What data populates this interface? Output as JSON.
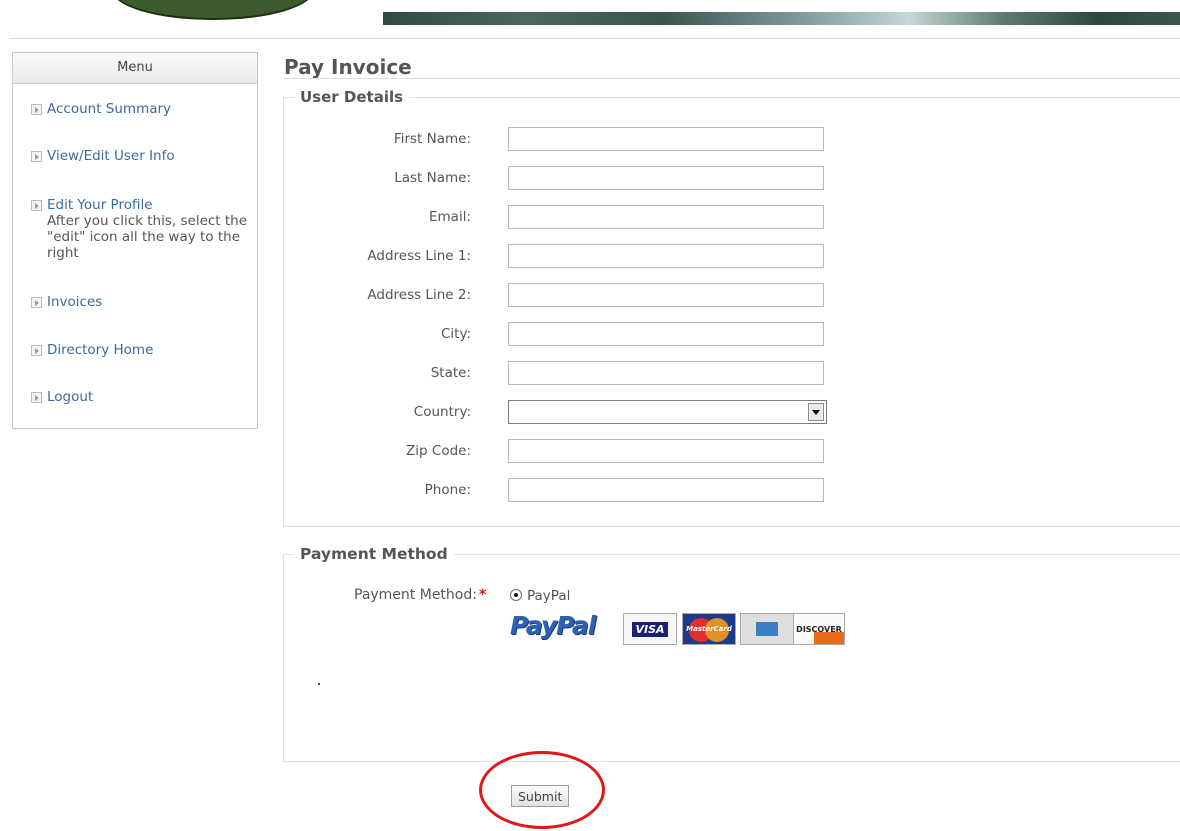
{
  "menu": {
    "title": "Menu",
    "items": [
      {
        "label": "Account Summary"
      },
      {
        "label": "View/Edit User Info"
      },
      {
        "label": "Edit Your Profile",
        "note": "After you click this, select the \"edit\" icon all the way to the right"
      },
      {
        "label": "Invoices"
      },
      {
        "label": "Directory Home"
      },
      {
        "label": "Logout"
      }
    ]
  },
  "page": {
    "title": "Pay Invoice"
  },
  "user_details": {
    "legend": "User Details",
    "fields": {
      "first_name": {
        "label": "First Name:",
        "value": ""
      },
      "last_name": {
        "label": "Last Name:",
        "value": ""
      },
      "email": {
        "label": "Email:",
        "value": ""
      },
      "address1": {
        "label": "Address Line 1:",
        "value": ""
      },
      "address2": {
        "label": "Address Line 2:",
        "value": ""
      },
      "city": {
        "label": "City:",
        "value": ""
      },
      "state": {
        "label": "State:",
        "value": ""
      },
      "country": {
        "label": "Country:",
        "value": ""
      },
      "zip": {
        "label": "Zip Code:",
        "value": ""
      },
      "phone": {
        "label": "Phone:",
        "value": ""
      }
    }
  },
  "payment": {
    "legend": "Payment Method",
    "label": "Payment Method:",
    "required_mark": "*",
    "option": "PayPal",
    "logo_text": "PayPal",
    "cards": {
      "visa": "VISA",
      "mastercard": "MasterCard",
      "discover": "DISCOVER"
    }
  },
  "submit_label": "Submit",
  "colors": {
    "link": "#3d6a9e",
    "required": "#dd1111",
    "highlight_circle": "#e01818"
  }
}
